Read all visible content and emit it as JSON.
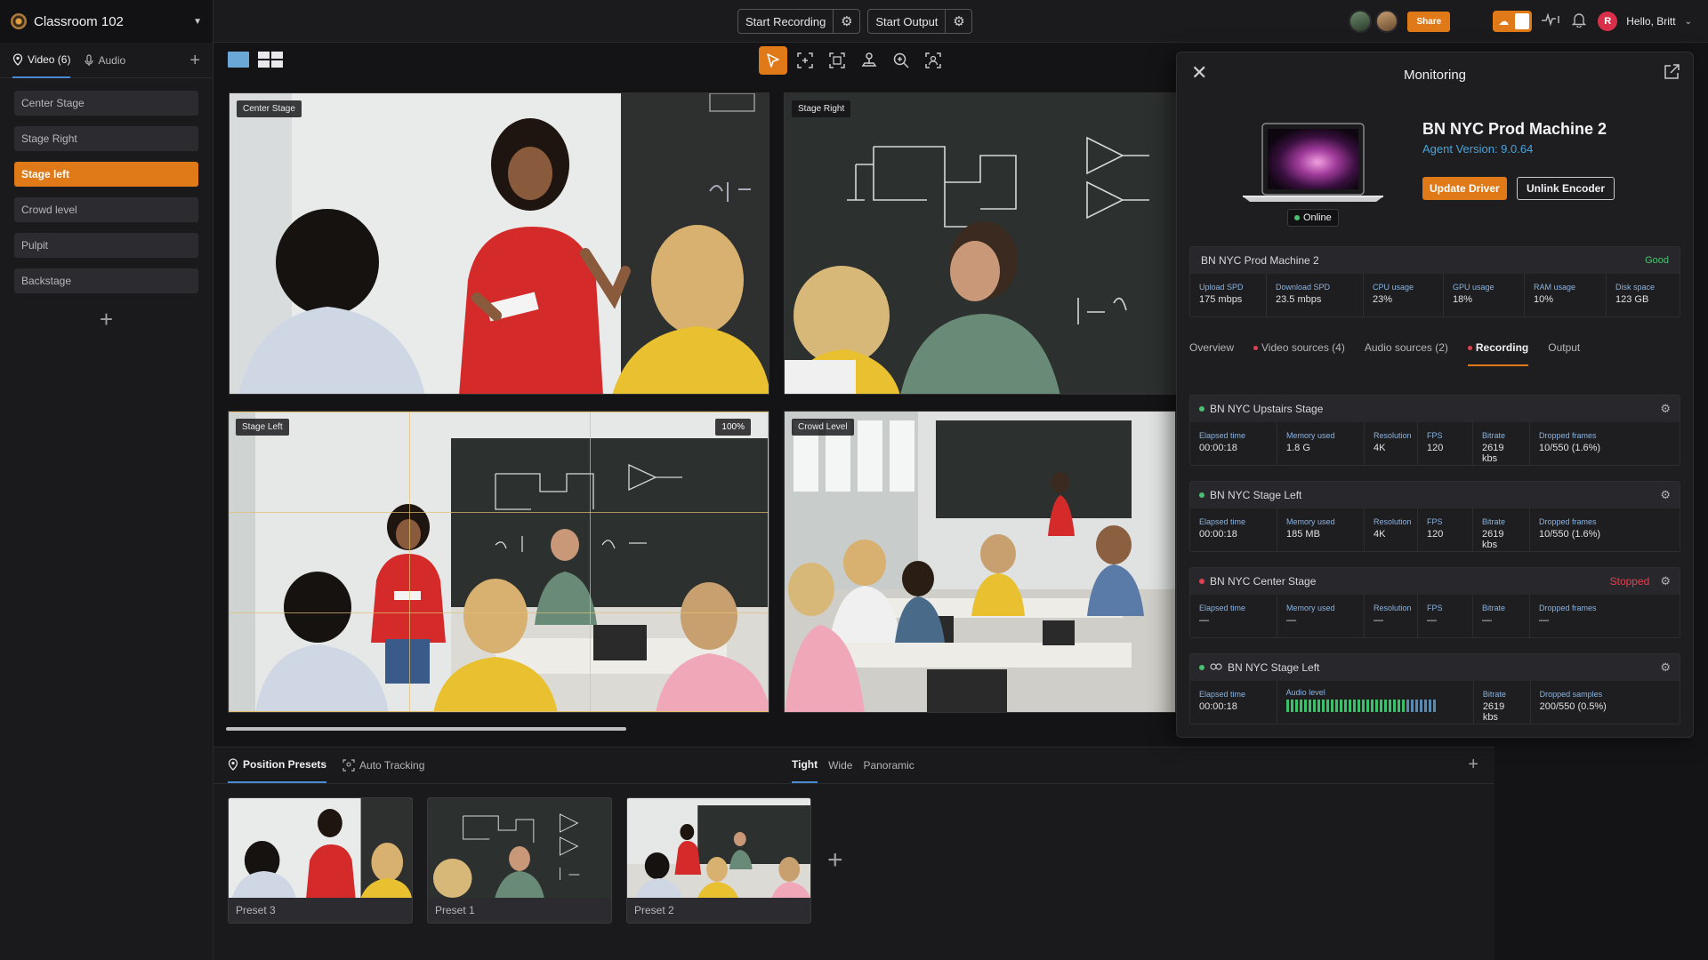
{
  "room": {
    "title": "Classroom 102"
  },
  "topbar": {
    "start_recording": "Start Recording",
    "start_output": "Start Output",
    "share": "Share",
    "user_initial": "R",
    "greeting": "Hello, Britt"
  },
  "sidebar": {
    "tabs": [
      {
        "label": "Video (6)"
      },
      {
        "label": "Audio"
      }
    ],
    "sources": [
      {
        "label": "Center Stage"
      },
      {
        "label": "Stage Right"
      },
      {
        "label": "Stage left"
      },
      {
        "label": "Crowd level"
      },
      {
        "label": "Pulpit"
      },
      {
        "label": "Backstage"
      }
    ]
  },
  "feeds": [
    {
      "label": "Center Stage"
    },
    {
      "label": "Stage Right"
    },
    {
      "label": "Stage Left",
      "zoom": "100%"
    },
    {
      "label": "Crowd Level"
    }
  ],
  "presets": {
    "tabs": [
      {
        "label": "Position Presets"
      },
      {
        "label": "Auto Tracking"
      }
    ],
    "zoom_tabs": [
      {
        "label": "Tight"
      },
      {
        "label": "Wide"
      },
      {
        "label": "Panoramic"
      }
    ],
    "items": [
      {
        "label": "Preset 3"
      },
      {
        "label": "Preset 1"
      },
      {
        "label": "Preset 2"
      }
    ]
  },
  "monitoring": {
    "title": "Monitoring",
    "machine_name": "BN NYC Prod Machine 2",
    "agent_version": "Agent Version: 9.0.64",
    "status": "Online",
    "update_driver": "Update Driver",
    "unlink_encoder": "Unlink Encoder",
    "health": {
      "name": "BN NYC Prod Machine 2",
      "status": "Good",
      "stats": [
        {
          "label": "Upload SPD",
          "value": "175 mbps"
        },
        {
          "label": "Download SPD",
          "value": "23.5 mbps"
        },
        {
          "label": "CPU usage",
          "value": "23%"
        },
        {
          "label": "GPU usage",
          "value": "18%"
        },
        {
          "label": "RAM usage",
          "value": "10%"
        },
        {
          "label": "Disk space",
          "value": "123 GB"
        }
      ]
    },
    "tabs": [
      {
        "label": "Overview"
      },
      {
        "label": "Video sources (4)"
      },
      {
        "label": "Audio sources (2)"
      },
      {
        "label": "Recording"
      },
      {
        "label": "Output"
      }
    ],
    "recordings": [
      {
        "name": "BN NYC Upstairs Stage",
        "fields": [
          {
            "label": "Elapsed time",
            "value": "00:00:18"
          },
          {
            "label": "Memory used",
            "value": "1.8 G"
          },
          {
            "label": "Resolution",
            "value": "4K"
          },
          {
            "label": "FPS",
            "value": "120"
          },
          {
            "label": "Bitrate",
            "value": "2619 kbs"
          },
          {
            "label": "Dropped frames",
            "value": "10/550 (1.6%)"
          }
        ]
      },
      {
        "name": "BN NYC Stage Left",
        "fields": [
          {
            "label": "Elapsed time",
            "value": "00:00:18"
          },
          {
            "label": "Memory used",
            "value": "185 MB"
          },
          {
            "label": "Resolution",
            "value": "4K"
          },
          {
            "label": "FPS",
            "value": "120"
          },
          {
            "label": "Bitrate",
            "value": "2619 kbs"
          },
          {
            "label": "Dropped frames",
            "value": "10/550 (1.6%)"
          }
        ]
      },
      {
        "name": "BN NYC Center Stage",
        "status": "Stopped",
        "fields": [
          {
            "label": "Elapsed time",
            "value": "—"
          },
          {
            "label": "Memory used",
            "value": "—"
          },
          {
            "label": "Resolution",
            "value": "—"
          },
          {
            "label": "FPS",
            "value": "—"
          },
          {
            "label": "Bitrate",
            "value": "—"
          },
          {
            "label": "Dropped frames",
            "value": "—"
          }
        ]
      },
      {
        "name": "BN NYC Stage Left",
        "fields": [
          {
            "label": "Elapsed time",
            "value": "00:00:18"
          },
          {
            "label": "Audio level"
          },
          {
            "label": "Bitrate",
            "value": "2619 kbs"
          },
          {
            "label": "Dropped samples",
            "value": "200/550 (0.5%)"
          }
        ],
        "audio_level": 0.8
      }
    ]
  },
  "colors": {
    "accent": "#e07a18",
    "link": "#4aa3d8",
    "ok": "#4cc070",
    "alert": "#e04050"
  }
}
